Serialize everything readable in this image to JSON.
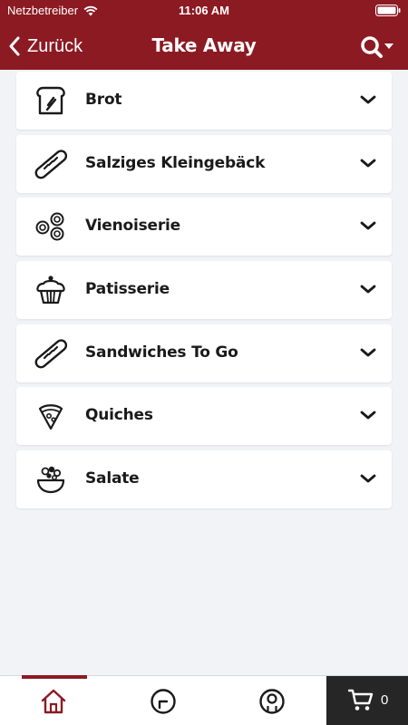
{
  "status_bar": {
    "carrier": "Netzbetreiber",
    "time": "11:06 AM"
  },
  "header": {
    "back_label": "Zurück",
    "title": "Take Away",
    "search_icon": "search-dropdown-icon",
    "background": "#8c1a22"
  },
  "categories": [
    {
      "label": "Brot",
      "icon": "bread-icon"
    },
    {
      "label": "Salziges Kleingebäck",
      "icon": "baguette-icon"
    },
    {
      "label": "Vienoiserie",
      "icon": "pastry-rings-icon"
    },
    {
      "label": "Patisserie",
      "icon": "cupcake-icon"
    },
    {
      "label": "Sandwiches To Go",
      "icon": "baguette-icon"
    },
    {
      "label": "Quiches",
      "icon": "pizza-slice-icon"
    },
    {
      "label": "Salate",
      "icon": "salad-bowl-icon"
    }
  ],
  "tab_bar": {
    "items": [
      {
        "name": "home",
        "icon": "home-icon",
        "active": true
      },
      {
        "name": "history",
        "icon": "clock-icon",
        "active": false
      },
      {
        "name": "profile",
        "icon": "user-icon",
        "active": false
      }
    ],
    "cart": {
      "icon": "cart-icon",
      "count": "0"
    },
    "accent": "#8c1a22"
  }
}
